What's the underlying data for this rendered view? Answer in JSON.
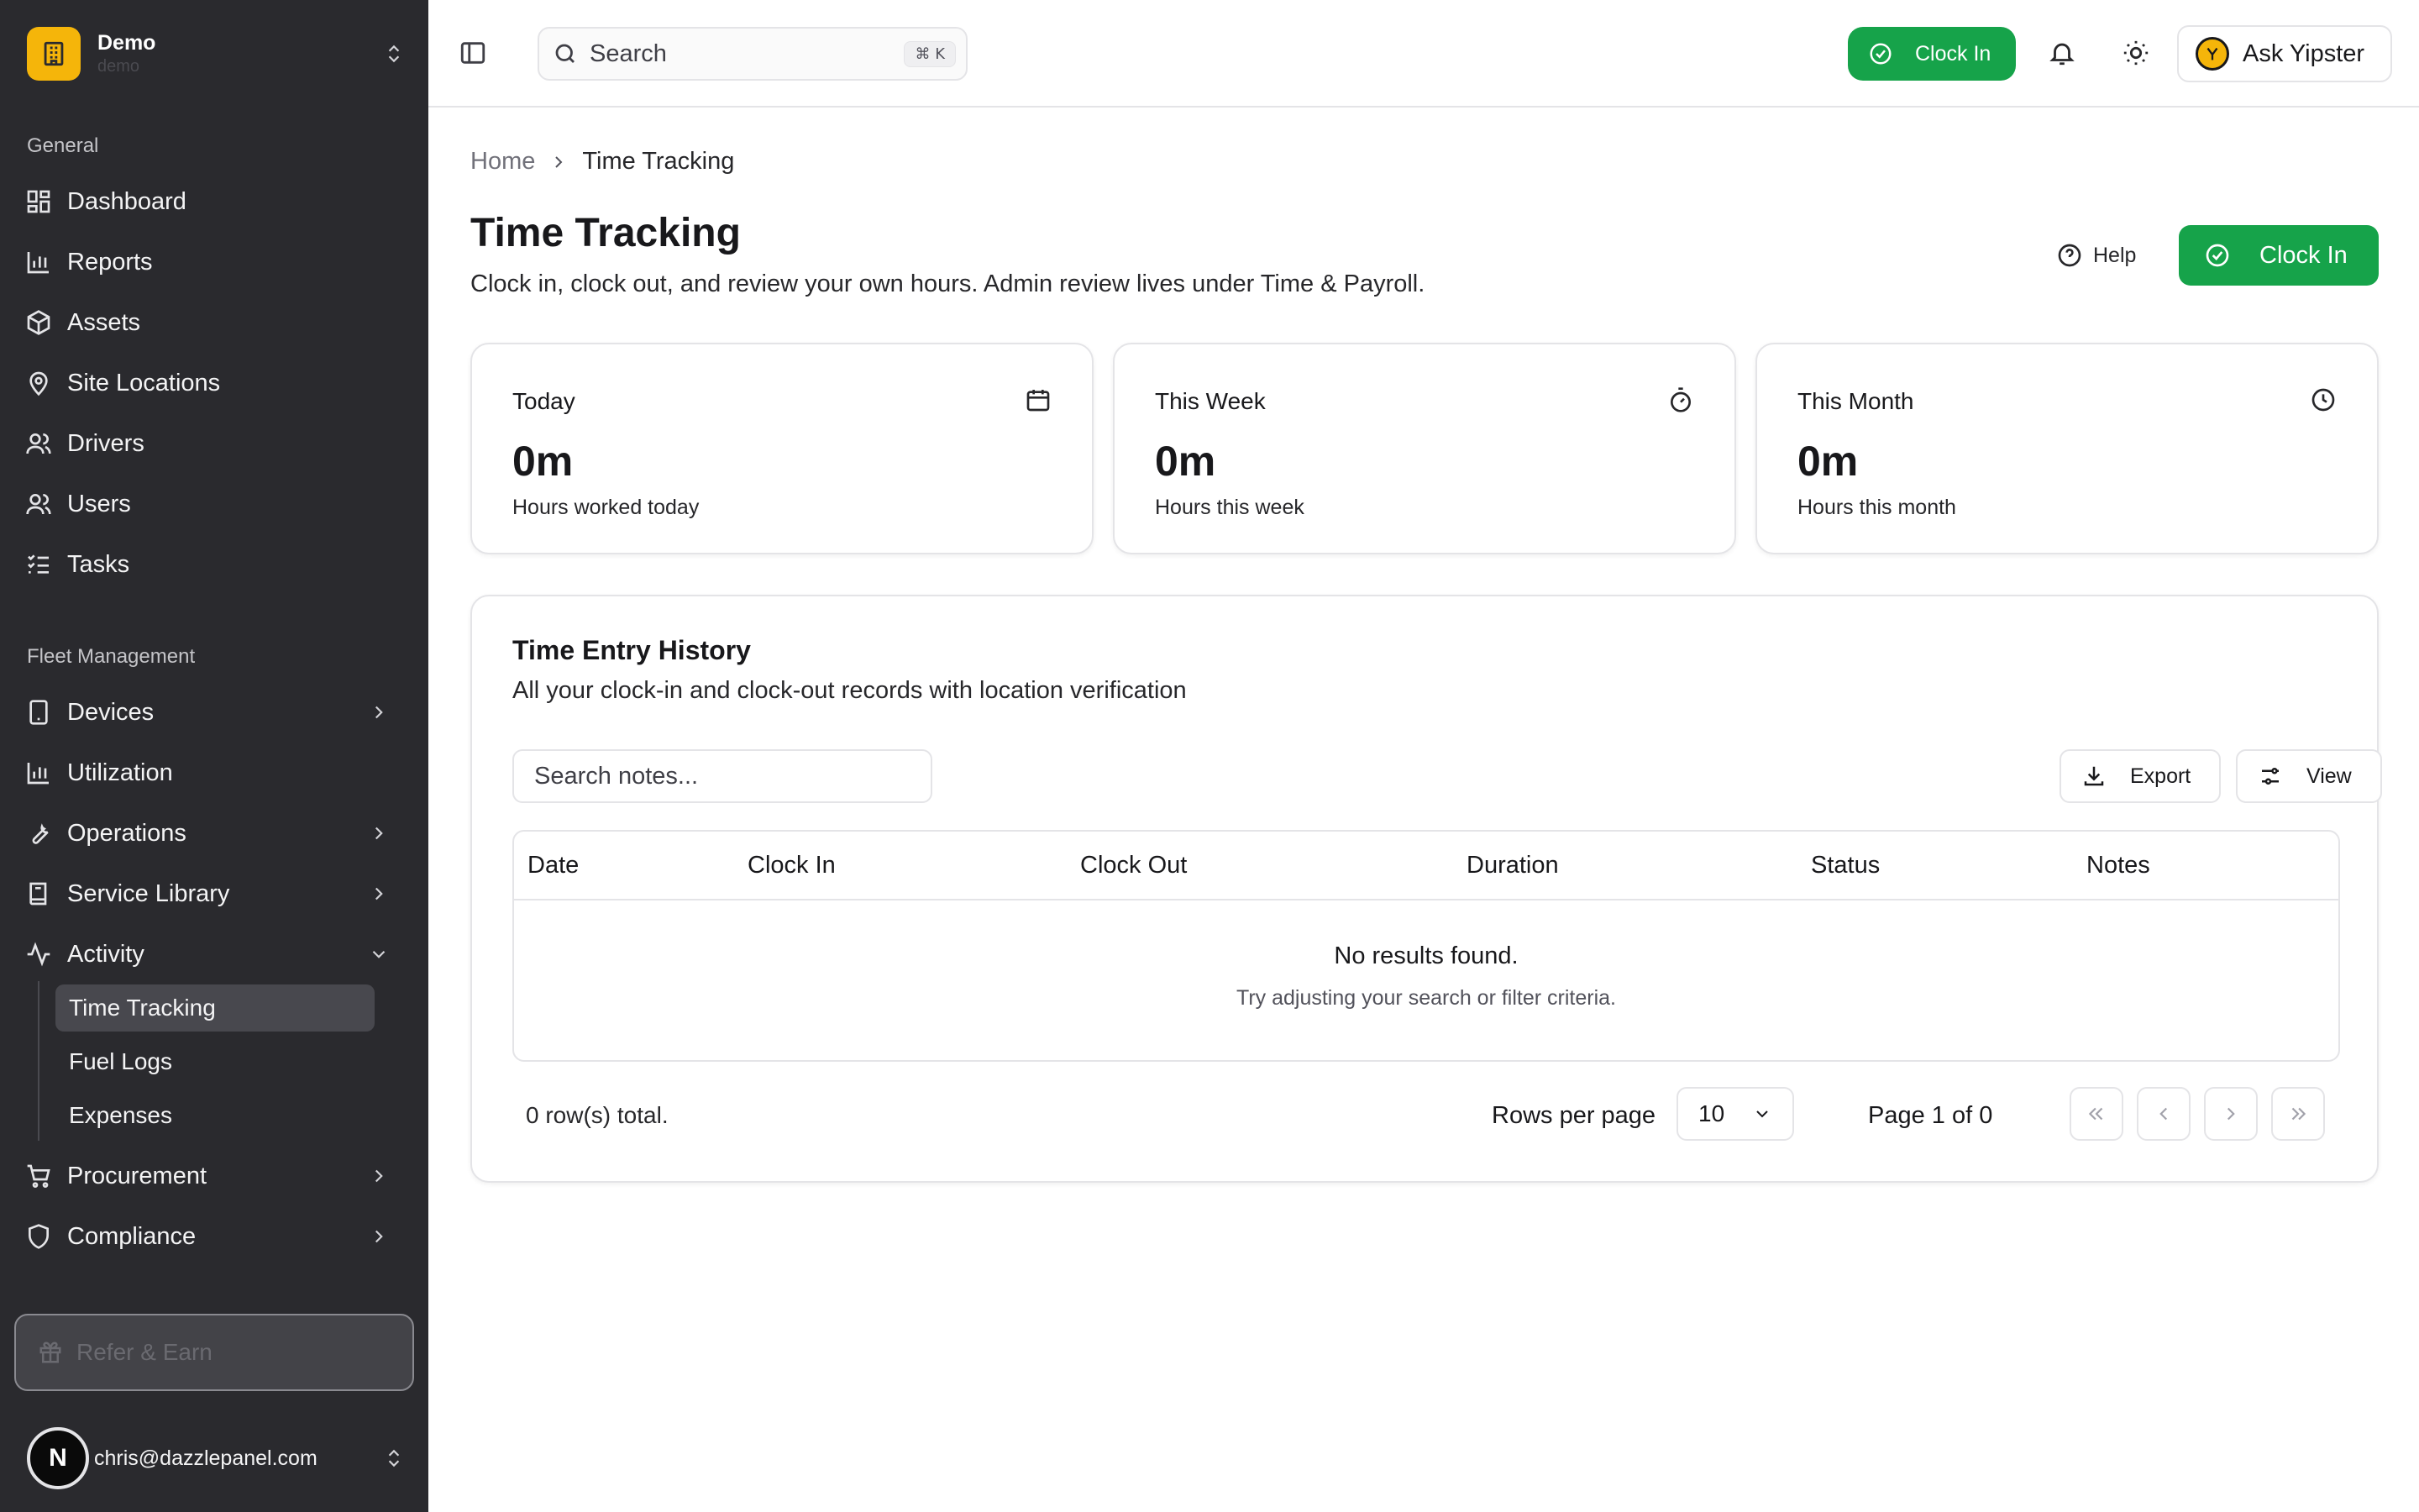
{
  "sidebar": {
    "org": {
      "name": "Demo",
      "sub": "demo"
    },
    "sections": {
      "general": "General",
      "fleet": "Fleet Management"
    },
    "general_items": [
      {
        "label": "Dashboard"
      },
      {
        "label": "Reports"
      },
      {
        "label": "Assets"
      },
      {
        "label": "Site Locations"
      },
      {
        "label": "Drivers"
      },
      {
        "label": "Users"
      },
      {
        "label": "Tasks"
      }
    ],
    "fleet_items": [
      {
        "label": "Devices"
      },
      {
        "label": "Utilization"
      },
      {
        "label": "Operations"
      },
      {
        "label": "Service Library"
      },
      {
        "label": "Activity"
      },
      {
        "label": "Procurement"
      },
      {
        "label": "Compliance"
      }
    ],
    "activity_sub": [
      {
        "label": "Time Tracking",
        "active": true
      },
      {
        "label": "Fuel Logs"
      },
      {
        "label": "Expenses"
      }
    ],
    "refer": "Refer & Earn",
    "user": {
      "avatar_letter": "N",
      "email": "chris@dazzlepanel.com"
    }
  },
  "topbar": {
    "search_label": "Search",
    "search_shortcut": "⌘ K",
    "clock_in": "Clock In",
    "ask": "Ask Yipster"
  },
  "breadcrumb": {
    "home": "Home",
    "current": "Time Tracking"
  },
  "page": {
    "title": "Time Tracking",
    "description": "Clock in, clock out, and review your own hours. Admin review lives under Time & Payroll.",
    "help": "Help",
    "clock_in": "Clock In"
  },
  "stats": [
    {
      "label": "Today",
      "value": "0m",
      "sub": "Hours worked today",
      "icon": "calendar-icon"
    },
    {
      "label": "This Week",
      "value": "0m",
      "sub": "Hours this week",
      "icon": "timer-icon"
    },
    {
      "label": "This Month",
      "value": "0m",
      "sub": "Hours this month",
      "icon": "clock-icon"
    }
  ],
  "history": {
    "title": "Time Entry History",
    "description": "All your clock-in and clock-out records with location verification",
    "search_placeholder": "Search notes...",
    "export": "Export",
    "view": "View",
    "columns": [
      "Date",
      "Clock In",
      "Clock Out",
      "Duration",
      "Status",
      "Notes"
    ],
    "empty_title": "No results found.",
    "empty_sub": "Try adjusting your search or filter criteria.",
    "rows_total": "0 row(s) total.",
    "rows_per_page_label": "Rows per page",
    "rows_per_page": "10",
    "page_info": "Page 1 of 0"
  },
  "colors": {
    "sidebar_bg": "#2a2a2e",
    "accent_green": "#16a34a",
    "brand_yellow": "#f5b50a"
  }
}
